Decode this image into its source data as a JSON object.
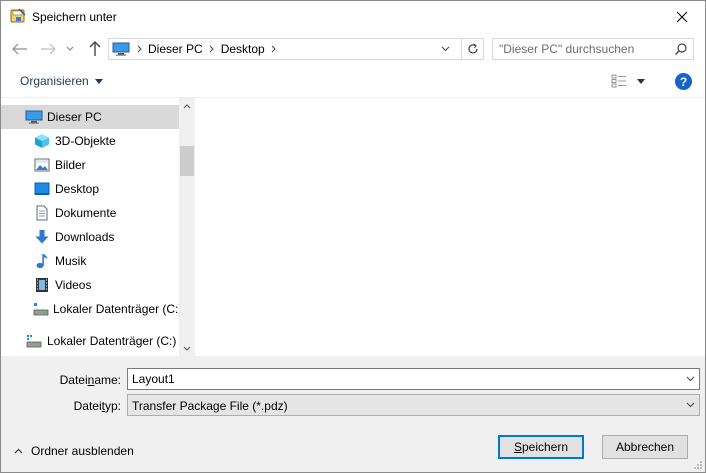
{
  "window": {
    "title": "Speichern unter",
    "app_icon": "save-dialog-icon",
    "close_icon": "close-icon"
  },
  "navbar": {
    "back_icon": "arrow-left-icon",
    "forward_icon": "arrow-right-icon",
    "recent_icon": "chevron-down-icon",
    "up_icon": "arrow-up-icon",
    "address_icon": "computer-icon",
    "breadcrumbs": [
      "Dieser PC",
      "Desktop"
    ],
    "search_placeholder": "\"Dieser PC\" durchsuchen"
  },
  "toolbar": {
    "organize_label": "Organisieren",
    "view_icon": "view-details-icon",
    "help_label": "?"
  },
  "sidebar": {
    "items": [
      {
        "label": "Dieser PC",
        "icon": "computer-icon",
        "selected": true
      },
      {
        "label": "3D-Objekte",
        "icon": "cube-3d-icon"
      },
      {
        "label": "Bilder",
        "icon": "pictures-icon"
      },
      {
        "label": "Desktop",
        "icon": "desktop-icon"
      },
      {
        "label": "Dokumente",
        "icon": "documents-icon"
      },
      {
        "label": "Downloads",
        "icon": "download-icon"
      },
      {
        "label": "Musik",
        "icon": "music-icon"
      },
      {
        "label": "Videos",
        "icon": "videos-icon"
      },
      {
        "label": "Lokaler Datenträger (C:)",
        "icon": "drive-icon"
      },
      {
        "label": "Lokaler Datenträger (C:)",
        "icon": "network-drive-icon"
      }
    ]
  },
  "form": {
    "filename_label_pre": "Datei",
    "filename_label_u": "n",
    "filename_label_post": "ame:",
    "filename_value": "Layout1",
    "filetype_label_pre": "Datei",
    "filetype_label_u": "t",
    "filetype_label_post": "yp:",
    "filetype_value": "Transfer Package File (*.pdz)",
    "hide_folders_label": "Ordner ausblenden",
    "save_label_u": "S",
    "save_label_rest": "peichern",
    "cancel_label": "Abbrechen"
  }
}
